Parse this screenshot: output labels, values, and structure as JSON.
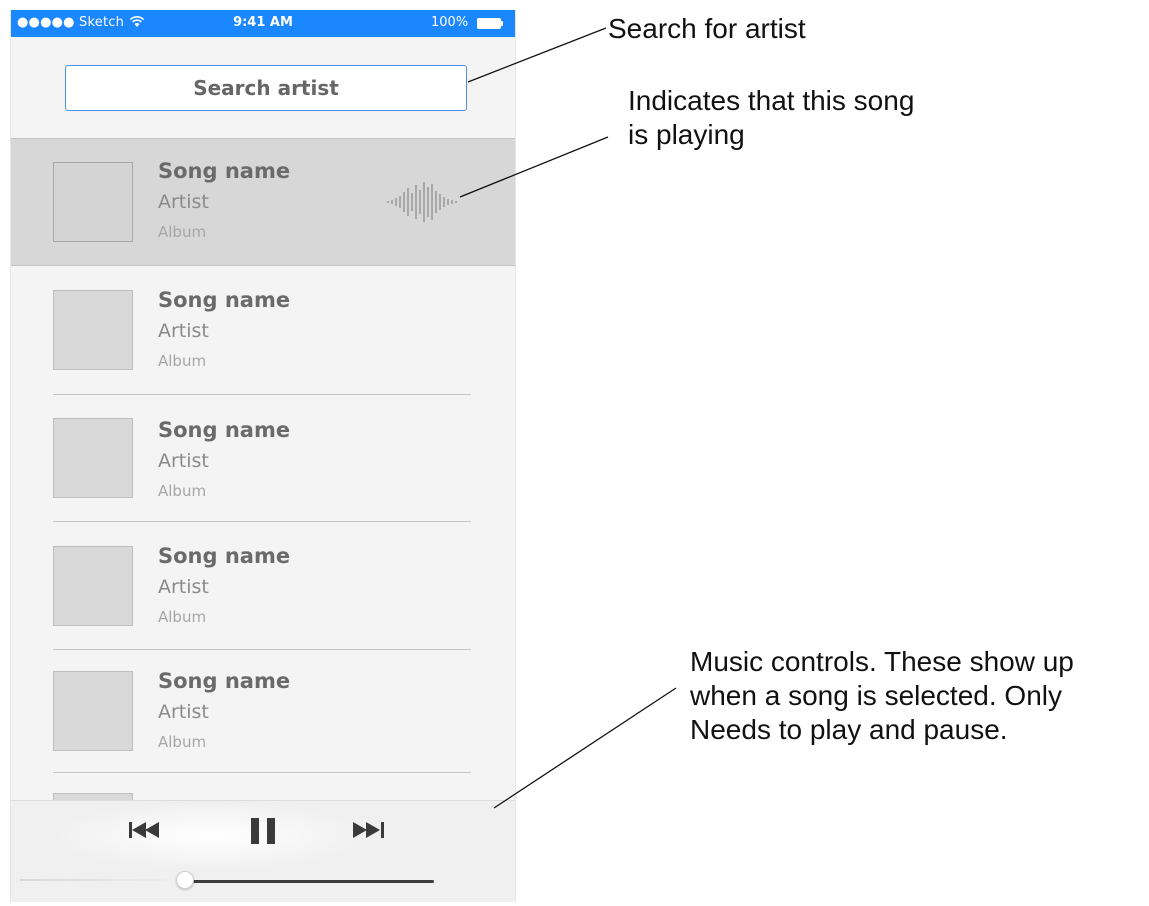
{
  "status_bar": {
    "carrier": "●●●●● Sketch",
    "time": "9:41 AM",
    "battery": "100%",
    "color": "#1a87ff"
  },
  "search": {
    "placeholder": "Search artist"
  },
  "songs": [
    {
      "name": "Song name",
      "artist": "Artist",
      "album": "Album",
      "playing": true
    },
    {
      "name": "Song name",
      "artist": "Artist",
      "album": "Album",
      "playing": false
    },
    {
      "name": "Song name",
      "artist": "Artist",
      "album": "Album",
      "playing": false
    },
    {
      "name": "Song name",
      "artist": "Artist",
      "album": "Album",
      "playing": false
    },
    {
      "name": "Song name",
      "artist": "Artist",
      "album": "Album",
      "playing": false
    }
  ],
  "controls": {
    "prev_icon": "skip-previous-icon",
    "pause_icon": "pause-icon",
    "next_icon": "skip-next-icon",
    "progress": 0.35
  },
  "annotations": {
    "search": "Search for artist",
    "playing_line1": "Indicates that this song",
    "playing_line2": "is playing",
    "controls_line1": "Music controls. These show up",
    "controls_line2": "when a song is selected. Only",
    "controls_line3": "Needs to play and pause."
  }
}
